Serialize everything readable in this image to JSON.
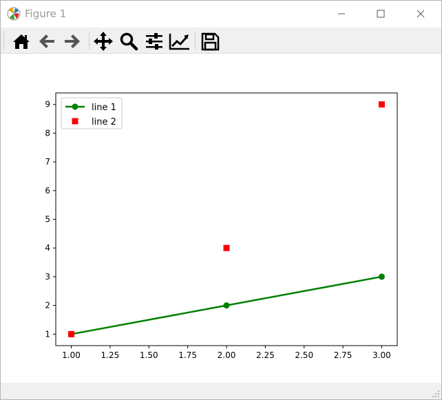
{
  "window": {
    "title": "Figure 1",
    "icon": "matplotlib-logo-icon",
    "controls": [
      "minimize-icon",
      "maximize-icon",
      "close-icon"
    ]
  },
  "toolbar": {
    "items": [
      {
        "name": "home",
        "icon": "home-icon"
      },
      {
        "name": "back",
        "icon": "arrow-left-icon"
      },
      {
        "name": "forward",
        "icon": "arrow-right-icon"
      },
      {
        "name": "pan",
        "icon": "move-icon"
      },
      {
        "name": "zoom",
        "icon": "magnifier-icon"
      },
      {
        "name": "subplots",
        "icon": "sliders-icon"
      },
      {
        "name": "customize",
        "icon": "line-chart-icon"
      },
      {
        "name": "save",
        "icon": "floppy-disk-icon"
      }
    ]
  },
  "chart_data": {
    "type": "line",
    "title": "",
    "xlabel": "",
    "ylabel": "",
    "xlim": [
      0.9,
      3.1
    ],
    "ylim": [
      0.6,
      9.4
    ],
    "xticks": [
      "1.00",
      "1.25",
      "1.50",
      "1.75",
      "2.00",
      "2.25",
      "2.50",
      "2.75",
      "3.00"
    ],
    "yticks": [
      "1",
      "2",
      "3",
      "4",
      "5",
      "6",
      "7",
      "8",
      "9"
    ],
    "grid": false,
    "legend_position": "top-left",
    "series": [
      {
        "name": "line 1",
        "x": [
          1,
          2,
          3
        ],
        "y": [
          1,
          2,
          3
        ],
        "color": "#008000",
        "style": "line",
        "marker": "circle"
      },
      {
        "name": "line 2",
        "x": [
          1,
          2,
          3
        ],
        "y": [
          1,
          4,
          9
        ],
        "color": "#ff0000",
        "style": "none",
        "marker": "square"
      }
    ]
  }
}
